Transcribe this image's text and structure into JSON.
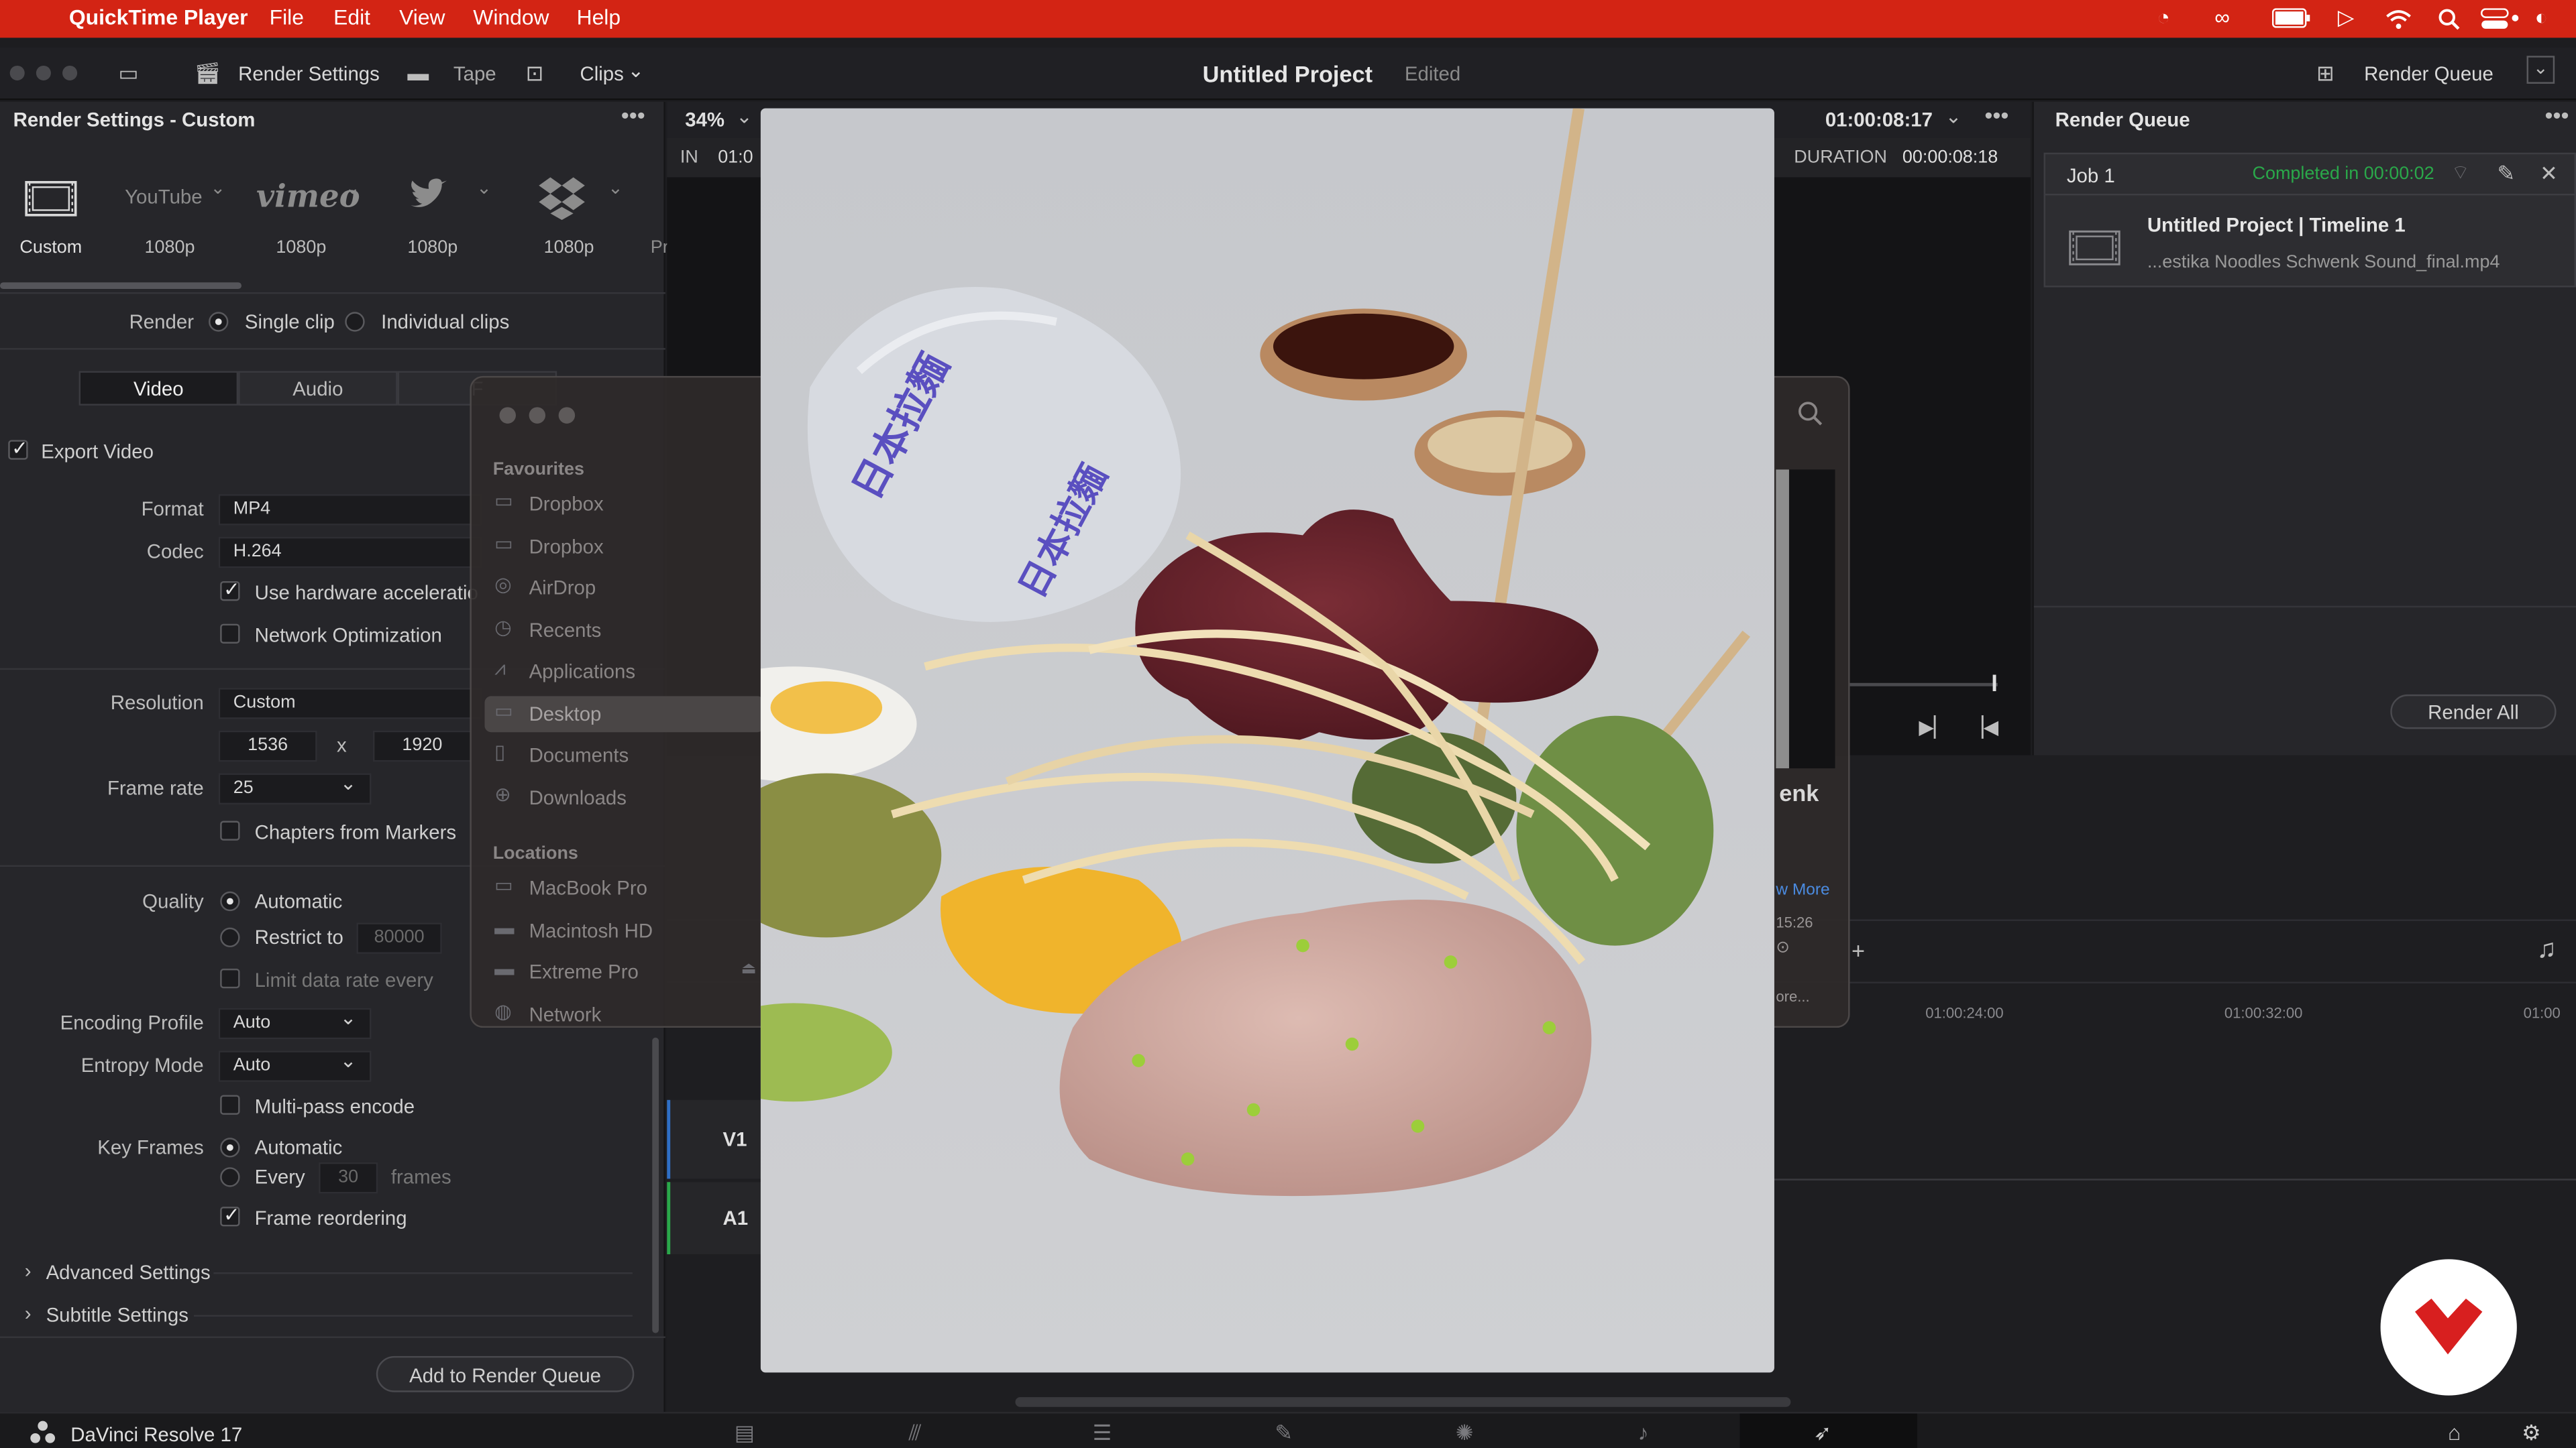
{
  "menubar": {
    "app": "QuickTime Player",
    "menus": [
      "File",
      "Edit",
      "View",
      "Window",
      "Help"
    ]
  },
  "toolbar": {
    "render_settings": "Render Settings",
    "tape": "Tape",
    "clips": "Clips",
    "project_title": "Untitled Project",
    "project_status": "Edited",
    "render_queue": "Render Queue"
  },
  "render_settings": {
    "title": "Render Settings - Custom",
    "presets": [
      {
        "name": "Custom",
        "sub": ""
      },
      {
        "name": "YouTube",
        "sub": "1080p"
      },
      {
        "name": "vimeo",
        "sub": "1080p"
      },
      {
        "name": "Twitter",
        "sub": "1080p"
      },
      {
        "name": "Dropbox",
        "sub": "1080p"
      },
      {
        "name": "",
        "sub": "Pr"
      }
    ],
    "render_label": "Render",
    "single_clip": "Single clip",
    "individual_clips": "Individual clips",
    "tabs": [
      "Video",
      "Audio",
      "F"
    ],
    "export_video": "Export Video",
    "format_label": "Format",
    "format_value": "MP4",
    "codec_label": "Codec",
    "codec_value": "H.264",
    "hw_accel": "Use hardware acceleratio",
    "network_opt": "Network Optimization",
    "resolution_label": "Resolution",
    "resolution_value": "Custom",
    "res_width": "1536",
    "res_x": "x",
    "res_height": "1920",
    "framerate_label": "Frame rate",
    "framerate_value": "25",
    "chapters": "Chapters from Markers",
    "quality_label": "Quality",
    "quality_auto": "Automatic",
    "restrict_to": "Restrict to",
    "restrict_value": "80000",
    "limit_rate": "Limit data rate every",
    "encoding_label": "Encoding Profile",
    "encoding_value": "Auto",
    "entropy_label": "Entropy Mode",
    "entropy_value": "Auto",
    "multipass": "Multi-pass encode",
    "keyframes_label": "Key Frames",
    "keyframes_auto": "Automatic",
    "keyframes_every": "Every",
    "keyframes_value": "30",
    "keyframes_unit": "frames",
    "frame_reorder": "Frame reordering",
    "advanced": "Advanced Settings",
    "subtitle": "Subtitle Settings",
    "add_queue": "Add to Render Queue"
  },
  "viewer": {
    "zoom": "34%",
    "in_label": "IN",
    "in_value": "01:0",
    "timecode": "01:00:08:17",
    "duration_label": "DURATION",
    "duration_value": "00:00:08:18"
  },
  "render_queue": {
    "title": "Render Queue",
    "job_label": "Job 1",
    "job_status": "Completed in 00:00:02",
    "job_title": "Untitled Project | Timeline 1",
    "job_file": "...estika Noodles Schwenk Sound_final.mp4",
    "render_all": "Render All"
  },
  "timeline": {
    "ticks": [
      "01:00:24:00",
      "01:00:32:00",
      "01:00"
    ],
    "track_v1": "V1",
    "track_a1": "A1"
  },
  "finder": {
    "favourites_label": "Favourites",
    "favourites": [
      "Dropbox",
      "Dropbox",
      "AirDrop",
      "Recents",
      "Applications",
      "Desktop",
      "Documents",
      "Downloads"
    ],
    "locations_label": "Locations",
    "locations": [
      "MacBook Pro",
      "Macintosh HD",
      "Extreme Pro",
      "Network"
    ],
    "peek_title": "enk",
    "peek_more": "w More",
    "peek_time": "15:26",
    "peek_more2": "ore..."
  },
  "video": {
    "glass_text": "日本拉麵"
  },
  "bottombar": {
    "app_name": "DaVinci Resolve 17"
  },
  "colors": {
    "menubar": "#d32414",
    "panel": "#26262a",
    "accent_completed": "#2aa84a",
    "logo_red": "#d81f1f"
  }
}
